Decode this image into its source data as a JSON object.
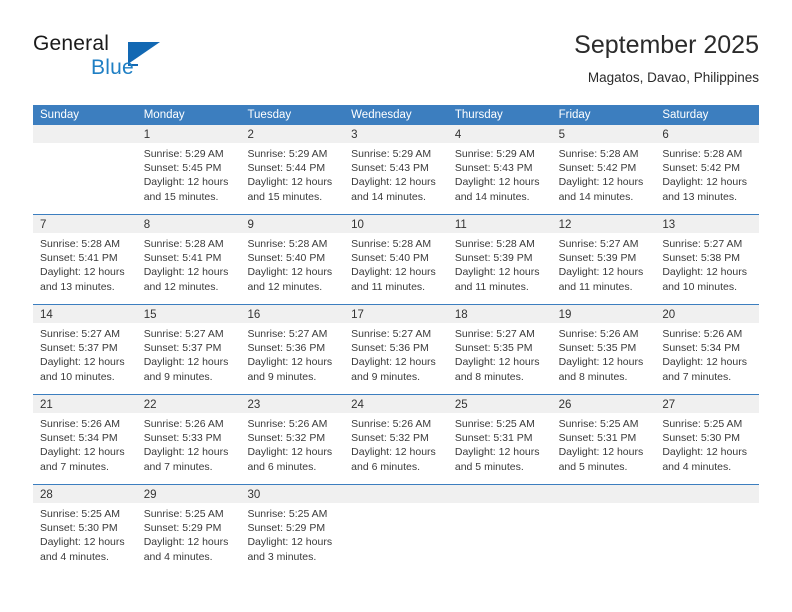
{
  "brand": {
    "word1": "General",
    "word2": "Blue",
    "logo_icon": "blue-triangle-icon",
    "accent_color": "#1268b3"
  },
  "header": {
    "title": "September 2025",
    "location": "Magatos, Davao, Philippines"
  },
  "calendar": {
    "header_bg": "#3c7ebf",
    "daynum_bg": "#f0f0f0",
    "weekdays": [
      "Sunday",
      "Monday",
      "Tuesday",
      "Wednesday",
      "Thursday",
      "Friday",
      "Saturday"
    ],
    "weeks": [
      [
        {
          "day": "",
          "sunrise": "",
          "sunset": "",
          "daylight1": "",
          "daylight2": ""
        },
        {
          "day": "1",
          "sunrise": "Sunrise: 5:29 AM",
          "sunset": "Sunset: 5:45 PM",
          "daylight1": "Daylight: 12 hours",
          "daylight2": "and 15 minutes."
        },
        {
          "day": "2",
          "sunrise": "Sunrise: 5:29 AM",
          "sunset": "Sunset: 5:44 PM",
          "daylight1": "Daylight: 12 hours",
          "daylight2": "and 15 minutes."
        },
        {
          "day": "3",
          "sunrise": "Sunrise: 5:29 AM",
          "sunset": "Sunset: 5:43 PM",
          "daylight1": "Daylight: 12 hours",
          "daylight2": "and 14 minutes."
        },
        {
          "day": "4",
          "sunrise": "Sunrise: 5:29 AM",
          "sunset": "Sunset: 5:43 PM",
          "daylight1": "Daylight: 12 hours",
          "daylight2": "and 14 minutes."
        },
        {
          "day": "5",
          "sunrise": "Sunrise: 5:28 AM",
          "sunset": "Sunset: 5:42 PM",
          "daylight1": "Daylight: 12 hours",
          "daylight2": "and 14 minutes."
        },
        {
          "day": "6",
          "sunrise": "Sunrise: 5:28 AM",
          "sunset": "Sunset: 5:42 PM",
          "daylight1": "Daylight: 12 hours",
          "daylight2": "and 13 minutes."
        }
      ],
      [
        {
          "day": "7",
          "sunrise": "Sunrise: 5:28 AM",
          "sunset": "Sunset: 5:41 PM",
          "daylight1": "Daylight: 12 hours",
          "daylight2": "and 13 minutes."
        },
        {
          "day": "8",
          "sunrise": "Sunrise: 5:28 AM",
          "sunset": "Sunset: 5:41 PM",
          "daylight1": "Daylight: 12 hours",
          "daylight2": "and 12 minutes."
        },
        {
          "day": "9",
          "sunrise": "Sunrise: 5:28 AM",
          "sunset": "Sunset: 5:40 PM",
          "daylight1": "Daylight: 12 hours",
          "daylight2": "and 12 minutes."
        },
        {
          "day": "10",
          "sunrise": "Sunrise: 5:28 AM",
          "sunset": "Sunset: 5:40 PM",
          "daylight1": "Daylight: 12 hours",
          "daylight2": "and 11 minutes."
        },
        {
          "day": "11",
          "sunrise": "Sunrise: 5:28 AM",
          "sunset": "Sunset: 5:39 PM",
          "daylight1": "Daylight: 12 hours",
          "daylight2": "and 11 minutes."
        },
        {
          "day": "12",
          "sunrise": "Sunrise: 5:27 AM",
          "sunset": "Sunset: 5:39 PM",
          "daylight1": "Daylight: 12 hours",
          "daylight2": "and 11 minutes."
        },
        {
          "day": "13",
          "sunrise": "Sunrise: 5:27 AM",
          "sunset": "Sunset: 5:38 PM",
          "daylight1": "Daylight: 12 hours",
          "daylight2": "and 10 minutes."
        }
      ],
      [
        {
          "day": "14",
          "sunrise": "Sunrise: 5:27 AM",
          "sunset": "Sunset: 5:37 PM",
          "daylight1": "Daylight: 12 hours",
          "daylight2": "and 10 minutes."
        },
        {
          "day": "15",
          "sunrise": "Sunrise: 5:27 AM",
          "sunset": "Sunset: 5:37 PM",
          "daylight1": "Daylight: 12 hours",
          "daylight2": "and 9 minutes."
        },
        {
          "day": "16",
          "sunrise": "Sunrise: 5:27 AM",
          "sunset": "Sunset: 5:36 PM",
          "daylight1": "Daylight: 12 hours",
          "daylight2": "and 9 minutes."
        },
        {
          "day": "17",
          "sunrise": "Sunrise: 5:27 AM",
          "sunset": "Sunset: 5:36 PM",
          "daylight1": "Daylight: 12 hours",
          "daylight2": "and 9 minutes."
        },
        {
          "day": "18",
          "sunrise": "Sunrise: 5:27 AM",
          "sunset": "Sunset: 5:35 PM",
          "daylight1": "Daylight: 12 hours",
          "daylight2": "and 8 minutes."
        },
        {
          "day": "19",
          "sunrise": "Sunrise: 5:26 AM",
          "sunset": "Sunset: 5:35 PM",
          "daylight1": "Daylight: 12 hours",
          "daylight2": "and 8 minutes."
        },
        {
          "day": "20",
          "sunrise": "Sunrise: 5:26 AM",
          "sunset": "Sunset: 5:34 PM",
          "daylight1": "Daylight: 12 hours",
          "daylight2": "and 7 minutes."
        }
      ],
      [
        {
          "day": "21",
          "sunrise": "Sunrise: 5:26 AM",
          "sunset": "Sunset: 5:34 PM",
          "daylight1": "Daylight: 12 hours",
          "daylight2": "and 7 minutes."
        },
        {
          "day": "22",
          "sunrise": "Sunrise: 5:26 AM",
          "sunset": "Sunset: 5:33 PM",
          "daylight1": "Daylight: 12 hours",
          "daylight2": "and 7 minutes."
        },
        {
          "day": "23",
          "sunrise": "Sunrise: 5:26 AM",
          "sunset": "Sunset: 5:32 PM",
          "daylight1": "Daylight: 12 hours",
          "daylight2": "and 6 minutes."
        },
        {
          "day": "24",
          "sunrise": "Sunrise: 5:26 AM",
          "sunset": "Sunset: 5:32 PM",
          "daylight1": "Daylight: 12 hours",
          "daylight2": "and 6 minutes."
        },
        {
          "day": "25",
          "sunrise": "Sunrise: 5:25 AM",
          "sunset": "Sunset: 5:31 PM",
          "daylight1": "Daylight: 12 hours",
          "daylight2": "and 5 minutes."
        },
        {
          "day": "26",
          "sunrise": "Sunrise: 5:25 AM",
          "sunset": "Sunset: 5:31 PM",
          "daylight1": "Daylight: 12 hours",
          "daylight2": "and 5 minutes."
        },
        {
          "day": "27",
          "sunrise": "Sunrise: 5:25 AM",
          "sunset": "Sunset: 5:30 PM",
          "daylight1": "Daylight: 12 hours",
          "daylight2": "and 4 minutes."
        }
      ],
      [
        {
          "day": "28",
          "sunrise": "Sunrise: 5:25 AM",
          "sunset": "Sunset: 5:30 PM",
          "daylight1": "Daylight: 12 hours",
          "daylight2": "and 4 minutes."
        },
        {
          "day": "29",
          "sunrise": "Sunrise: 5:25 AM",
          "sunset": "Sunset: 5:29 PM",
          "daylight1": "Daylight: 12 hours",
          "daylight2": "and 4 minutes."
        },
        {
          "day": "30",
          "sunrise": "Sunrise: 5:25 AM",
          "sunset": "Sunset: 5:29 PM",
          "daylight1": "Daylight: 12 hours",
          "daylight2": "and 3 minutes."
        },
        {
          "day": "",
          "sunrise": "",
          "sunset": "",
          "daylight1": "",
          "daylight2": ""
        },
        {
          "day": "",
          "sunrise": "",
          "sunset": "",
          "daylight1": "",
          "daylight2": ""
        },
        {
          "day": "",
          "sunrise": "",
          "sunset": "",
          "daylight1": "",
          "daylight2": ""
        },
        {
          "day": "",
          "sunrise": "",
          "sunset": "",
          "daylight1": "",
          "daylight2": ""
        }
      ]
    ]
  }
}
